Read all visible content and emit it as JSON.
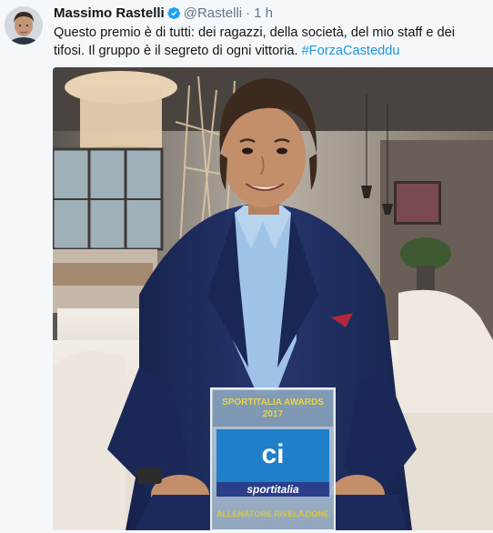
{
  "author": {
    "display_name": "Massimo Rastelli",
    "handle": "@Rastelli",
    "separator": "·",
    "timestamp": "1 h",
    "verified": true
  },
  "tweet": {
    "text_prefix": "Questo premio è di tutti: dei ragazzi, della società, del mio staff e dei tifosi. Il gruppo è il segreto di ogni vittoria. ",
    "hashtag": "#ForzaCasteddu"
  },
  "photo": {
    "trophy_line1": "SPORTITALIA AWARDS",
    "trophy_line2": "2017",
    "trophy_brand": "sportitalia",
    "trophy_footer": "ALLENATORE RIVELAZIONE"
  },
  "colors": {
    "link": "#1b95e0",
    "verified_badge": "#1da1f2",
    "secondary_text": "#657786",
    "jacket": "#1f2d5e",
    "shirt": "#9fc3e6",
    "trophy_blue": "#1f7fc9",
    "trophy_text": "#e6d548"
  },
  "icons": [
    "verified-badge-icon"
  ]
}
